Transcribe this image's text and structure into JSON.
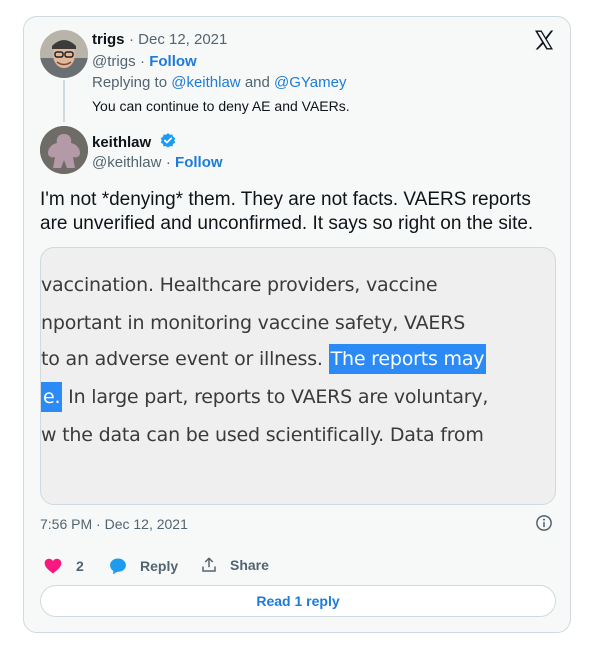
{
  "reply_tweet": {
    "display_name": "trigs",
    "date": "Dec 12, 2021",
    "handle": "@trigs",
    "follow_label": "Follow",
    "replying_prefix": "Replying to",
    "replying_to_1": "@keithlaw",
    "replying_and": "and",
    "replying_to_2": "@GYamey",
    "text": "You can continue to deny AE and VAERs."
  },
  "main_tweet": {
    "display_name": "keithlaw",
    "handle": "@keithlaw",
    "follow_label": "Follow",
    "text_line1": "I'm not *denying* them. They are not facts. VAERS reports",
    "text_line2": "are unverified and unconfirmed. It says so right on the site.",
    "timestamp": "7:56 PM · Dec 12, 2021"
  },
  "media": {
    "line1": "vaccination. Healthcare providers, vaccine",
    "line2": "nportant in monitoring vaccine safety, VAERS",
    "line3_plain": "to an adverse event or illness. ",
    "line3_highlight": "The reports may",
    "line4_highlight": "e.",
    "line4_plain": " In large part, reports to VAERS are voluntary,",
    "line5": "w the data can be used scientifically. Data from"
  },
  "actions": {
    "like_count": "2",
    "reply_label": "Reply",
    "share_label": "Share",
    "read_reply_label": "Read 1 reply"
  },
  "colors": {
    "accent": "#1d7bd8",
    "like": "#f91880",
    "highlight": "#2c8af7"
  }
}
